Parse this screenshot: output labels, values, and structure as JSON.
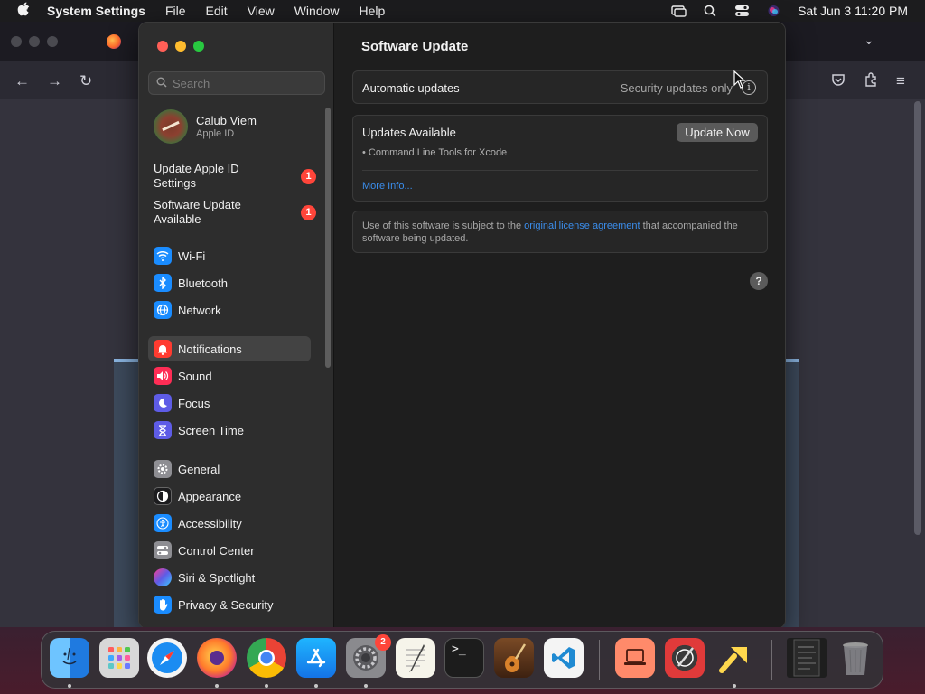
{
  "menubar": {
    "apple_icon": "apple-icon",
    "app_name": "System Settings",
    "menus": [
      "File",
      "Edit",
      "View",
      "Window",
      "Help"
    ],
    "datetime": "Sat Jun 3  11:20 PM",
    "status_icons": [
      "screen-mirroring-icon",
      "search-icon",
      "control-center-icon",
      "siri-icon"
    ]
  },
  "settings": {
    "search_placeholder": "Search",
    "profile": {
      "name": "Calub Viem",
      "subtitle": "Apple ID"
    },
    "notices": [
      {
        "label": "Update Apple ID Settings",
        "badge": "1"
      },
      {
        "label": "Software Update Available",
        "badge": "1"
      }
    ],
    "sidebar_items": [
      {
        "label": "Wi-Fi",
        "icon": "wifi-icon",
        "color": "#1a8cff"
      },
      {
        "label": "Bluetooth",
        "icon": "bluetooth-icon",
        "color": "#1a8cff"
      },
      {
        "label": "Network",
        "icon": "globe-icon",
        "color": "#1a8cff"
      },
      {
        "label": "Notifications",
        "icon": "bell-icon",
        "color": "#ff3b30",
        "selected": true
      },
      {
        "label": "Sound",
        "icon": "speaker-icon",
        "color": "#ff2d55"
      },
      {
        "label": "Focus",
        "icon": "moon-icon",
        "color": "#5e5ce6"
      },
      {
        "label": "Screen Time",
        "icon": "hourglass-icon",
        "color": "#5e5ce6"
      },
      {
        "label": "General",
        "icon": "gear-icon",
        "color": "#8e8e93"
      },
      {
        "label": "Appearance",
        "icon": "appearance-icon",
        "color": "#1c1c1e"
      },
      {
        "label": "Accessibility",
        "icon": "accessibility-icon",
        "color": "#1a8cff"
      },
      {
        "label": "Control Center",
        "icon": "toggles-icon",
        "color": "#8e8e93"
      },
      {
        "label": "Siri & Spotlight",
        "icon": "siri-icon",
        "color": "#bf5af2"
      },
      {
        "label": "Privacy & Security",
        "icon": "hand-icon",
        "color": "#1a8cff"
      }
    ],
    "main": {
      "title": "Software Update",
      "auto_updates_label": "Automatic updates",
      "auto_updates_value": "Security updates only",
      "updates_available_label": "Updates Available",
      "update_now_button": "Update Now",
      "update_item": "• Command Line Tools for Xcode",
      "more_info_link": "More Info...",
      "license_prefix": "Use of this software is subject to the ",
      "license_link": "original license agreement",
      "license_suffix": " that accompanied the software being updated.",
      "help_button": "?"
    }
  },
  "dock": {
    "apps": [
      "Finder",
      "Launchpad",
      "Safari",
      "Firefox",
      "Chrome",
      "App Store",
      "System Settings",
      "TextEdit",
      "Terminal",
      "GarageBand",
      "Visual Studio Code",
      "Screen Sharing",
      "Instruments",
      "Kite",
      "Document",
      "Trash"
    ],
    "system_settings_badge": "2"
  }
}
